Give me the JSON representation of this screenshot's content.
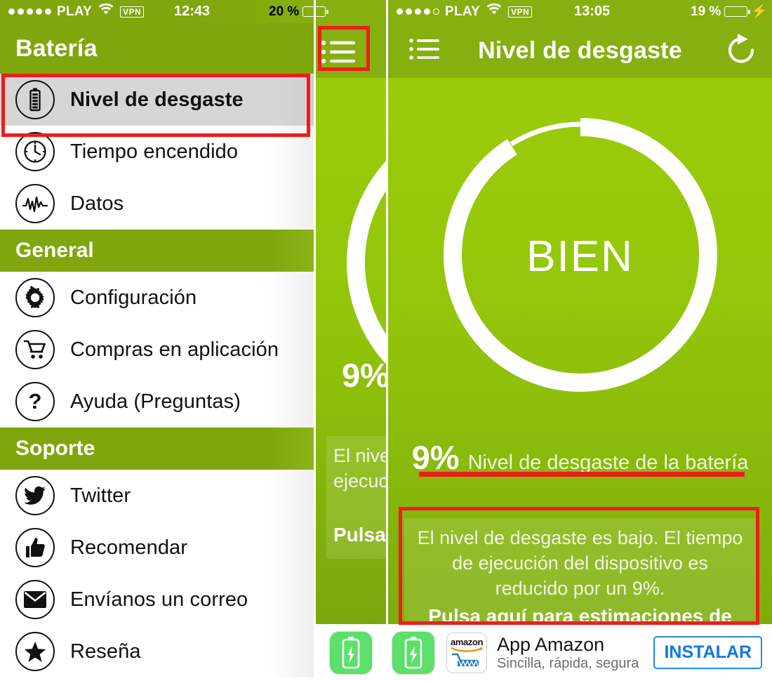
{
  "left_phone": {
    "status_bar": {
      "signal_dots_filled": 5,
      "signal_dots_total": 5,
      "carrier": "PLAY",
      "wifi_icon": "wifi-icon",
      "vpn_badge": "VPN",
      "time": "12:43",
      "battery_percent": "20 %",
      "battery_fill_pct": 20,
      "charging": false
    },
    "drawer": {
      "title": "Batería",
      "groups": [
        {
          "header": null,
          "items": [
            {
              "label": "Nivel de desgaste",
              "icon": "battery-icon",
              "selected": true
            },
            {
              "label": "Tiempo encendido",
              "icon": "clock-icon",
              "selected": false
            },
            {
              "label": "Datos",
              "icon": "pulse-icon",
              "selected": false
            }
          ]
        },
        {
          "header": "General",
          "items": [
            {
              "label": "Configuración",
              "icon": "gear-icon",
              "selected": false
            },
            {
              "label": "Compras en aplicación",
              "icon": "cart-icon",
              "selected": false
            },
            {
              "label": "Ayuda (Preguntas)",
              "icon": "question-icon",
              "selected": false
            }
          ]
        },
        {
          "header": "Soporte",
          "items": [
            {
              "label": "Twitter",
              "icon": "twitter-icon",
              "selected": false
            },
            {
              "label": "Recomendar",
              "icon": "thumbs-up-icon",
              "selected": false
            },
            {
              "label": "Envíanos un correo",
              "icon": "envelope-icon",
              "selected": false
            },
            {
              "label": "Reseña",
              "icon": "star-icon",
              "selected": false
            }
          ]
        }
      ]
    }
  },
  "middle_strip": {
    "status_bar": {
      "battery_percent": "20 %",
      "battery_fill_pct": 20
    },
    "menu_icon": "hamburger-list-icon",
    "peek_percent": "9%",
    "peek_info_line1": "El nive",
    "peek_info_line2": "ejecuc",
    "peek_info_line3": "Pulsa"
  },
  "right_phone": {
    "status_bar": {
      "signal_dots_filled": 4,
      "signal_dots_total": 5,
      "carrier": "PLAY",
      "wifi_icon": "wifi-icon",
      "vpn_badge": "VPN",
      "time": "13:05",
      "battery_percent": "19 %",
      "battery_fill_pct": 19,
      "charging": true
    },
    "navbar": {
      "menu_icon": "hamburger-list-icon",
      "title": "Nivel de desgaste",
      "refresh_icon": "refresh-icon"
    },
    "gauge": {
      "center_label": "BIEN",
      "value_pct": 9,
      "remaining_pct": 91,
      "ring_color": "#ffffff",
      "track_color": "#ffffff"
    },
    "summary": {
      "percent": "9%",
      "label": "Nivel de desgaste de la batería"
    },
    "info_panel": {
      "body": "El nivel de desgaste es bajo. El tiempo de ejecución del dispositivo es reducido por un 9%.",
      "cta": "Pulsa aquí para estimaciones de tiempo."
    },
    "ad": {
      "app_icon": "battery-charging-icon",
      "brand_icon": "amazon-cart-icon",
      "brand_word": "amazon",
      "title": "App Amazon",
      "subtitle": "Sincilla, rápida, segura",
      "install_label": "INSTALAR"
    }
  },
  "annotations": {
    "accent_color": "#F21B1B",
    "boxes": [
      "selected-menu-item-highlight",
      "hamburger-button-highlight",
      "wear-percentage-underline",
      "info-panel-highlight"
    ]
  },
  "theme": {
    "green_dark": "#7FA60C",
    "green_nav": "#86AF10",
    "green_bright": "#9BCC0A",
    "green_deep": "#7EAD0B",
    "red_accent": "#F21B1B",
    "install_blue": "#1278E3"
  }
}
